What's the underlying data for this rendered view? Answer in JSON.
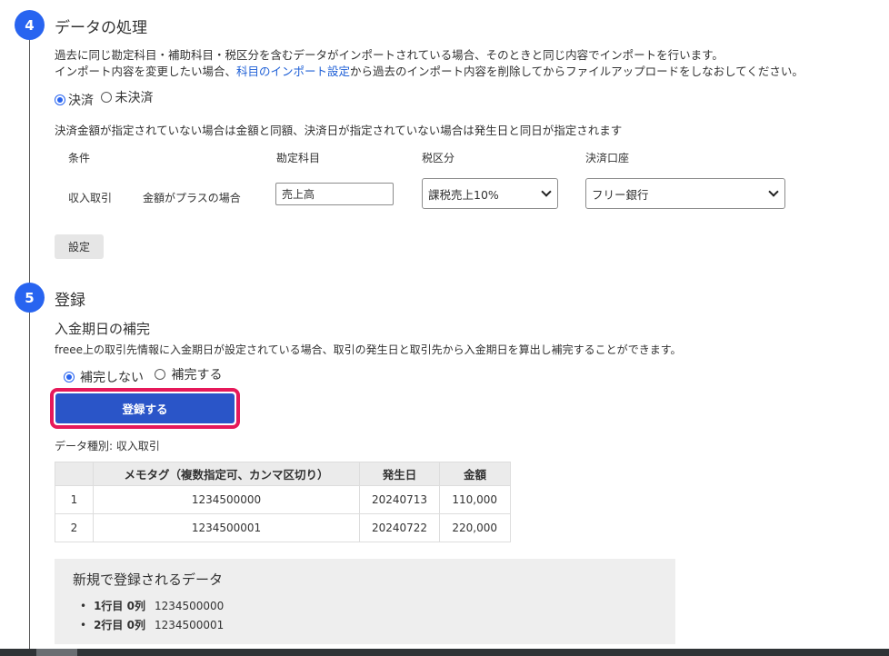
{
  "step4": {
    "number": "4",
    "title": "データの処理",
    "desc_line1": "過去に同じ勘定科目・補助科目・税区分を含むデータがインポートされている場合、そのときと同じ内容でインポートを行います。",
    "desc_line2_pre": "インポート内容を変更したい場合、",
    "desc_link": "科目のインポート設定",
    "desc_line2_post": "から過去のインポート内容を削除してからファイルアップロードをしなおしてください。",
    "radio_settled": "決済",
    "radio_unsettled": "未決済",
    "settle_note": "決済金額が指定されていない場合は金額と同額、決済日が指定されていない場合は発生日と同日が指定されます",
    "headers": {
      "condition": "条件",
      "account": "勘定科目",
      "tax": "税区分",
      "settlement": "決済口座"
    },
    "row": {
      "type": "収入取引",
      "condition": "金額がプラスの場合",
      "account_value": "売上高",
      "tax_value": "課税売上10%",
      "settlement_value": "フリー銀行"
    },
    "setting_button": "設定"
  },
  "step5": {
    "number": "5",
    "title": "登録",
    "subtitle": "入金期日の補完",
    "desc": "freee上の取引先情報に入金期日が設定されている場合、取引の発生日と取引先から入金期日を算出し補完することができます。",
    "radio_no": "補完しない",
    "radio_yes": "補完する",
    "register_button": "登録する",
    "data_type": "データ種別: 収入取引",
    "table": {
      "headers": [
        "",
        "メモタグ（複数指定可、カンマ区切り）",
        "発生日",
        "金額"
      ],
      "rows": [
        [
          "1",
          "1234500000",
          "20240713",
          "110,000"
        ],
        [
          "2",
          "1234500001",
          "20240722",
          "220,000"
        ]
      ]
    },
    "new_data": {
      "title": "新規で登録されるデータ",
      "items": [
        {
          "label": "1行目 0列",
          "value": "1234500000"
        },
        {
          "label": "2行目 0列",
          "value": "1234500001"
        }
      ]
    }
  },
  "colors": {
    "accent": "#2864f0",
    "primary_button": "#2a55c8",
    "highlight": "#e6195a",
    "link": "#1e5fd6"
  }
}
